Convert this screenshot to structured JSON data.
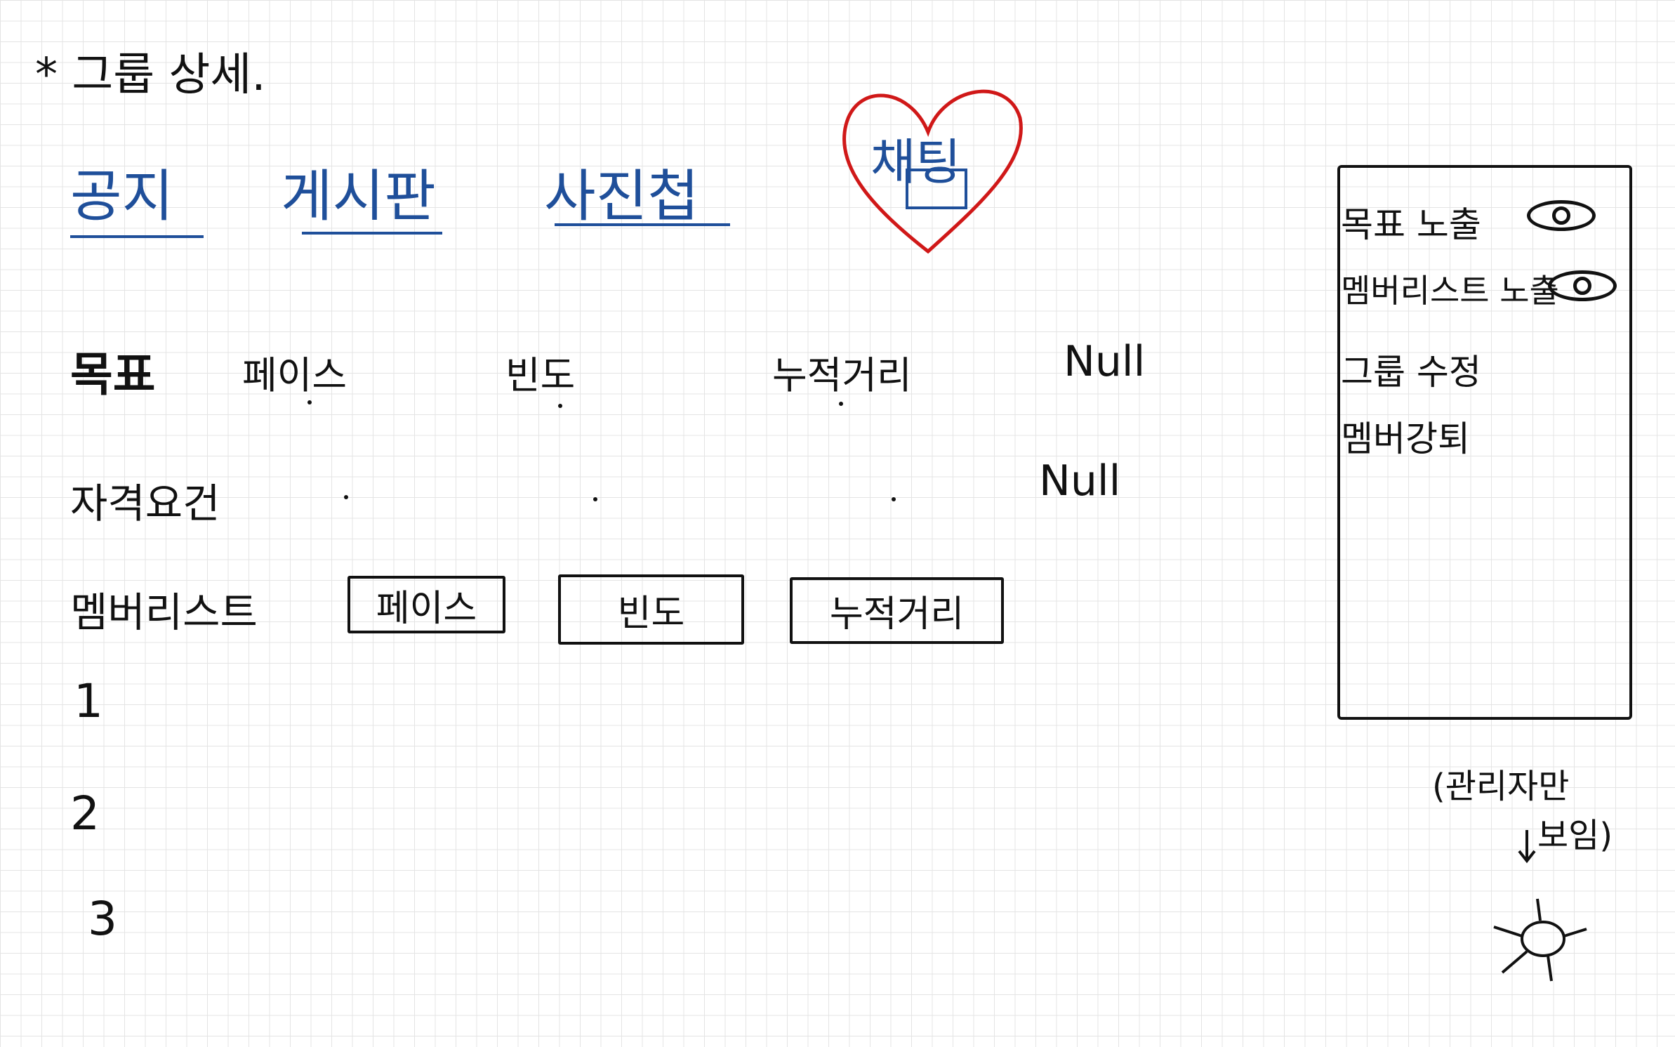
{
  "page": {
    "title": "* 그룹 상세."
  },
  "tabs": [
    {
      "label": "공지"
    },
    {
      "label": "게시판"
    },
    {
      "label": "사진첩"
    },
    {
      "label": "채팅"
    }
  ],
  "colors": {
    "tab_text": "#1f4f9a",
    "highlight_heart": "#d01818",
    "ink": "#111111"
  },
  "goal_row": {
    "label": "목표",
    "columns": [
      "페이스",
      "빈도",
      "누적거리"
    ],
    "null_label": "Null"
  },
  "qualification_row": {
    "label": "자격요건",
    "null_label": "Null"
  },
  "member_list": {
    "label": "멤버리스트",
    "sort_buttons": [
      "페이스",
      "빈도",
      "누적거리"
    ],
    "rows": [
      "1",
      "2",
      "3"
    ]
  },
  "admin_panel": {
    "items": [
      "목표 노출",
      "멤버리스트 노출",
      "그룹 수정",
      "멤버강퇴"
    ],
    "toggles_icon": "eye-icon",
    "note_line1": "(관리자만",
    "note_line2": "보임)",
    "trigger_icon": "sun-icon"
  }
}
